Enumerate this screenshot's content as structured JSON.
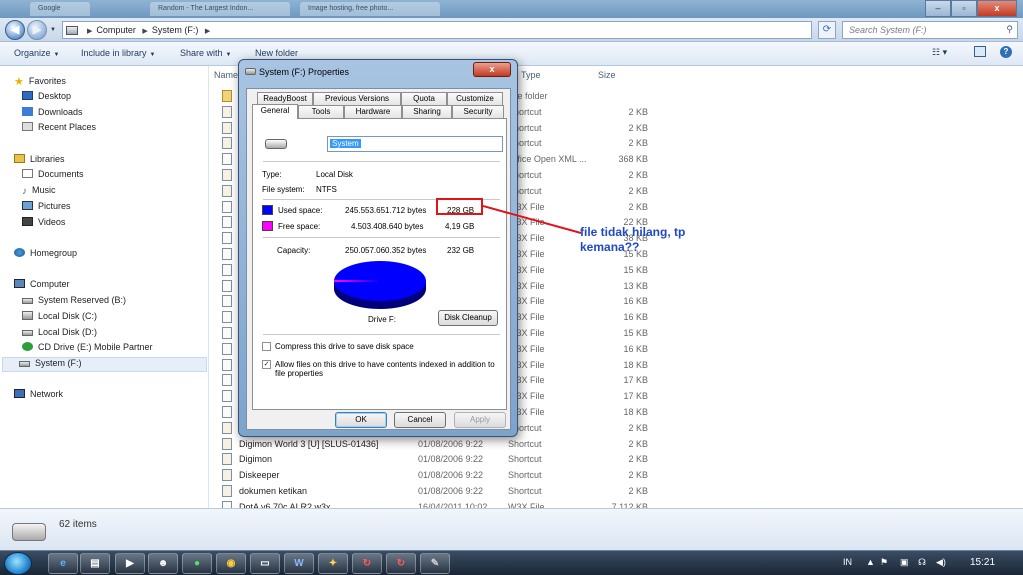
{
  "topbar": {
    "tab1": "Google",
    "tab2": "Random - The Largest Indon...",
    "tab3": "Image hosting, free photo..."
  },
  "window_buttons": {
    "minimize": "–",
    "maximize": "▫",
    "close": "x"
  },
  "address": {
    "crumbs": [
      "Computer",
      "System (F:)"
    ],
    "search_placeholder": "Search System (F:)"
  },
  "commands": {
    "organize": "Organize",
    "include": "Include in library",
    "share": "Share with",
    "newfolder": "New folder"
  },
  "columns": {
    "name": "Name",
    "date": "Date modified",
    "type": "Type",
    "size": "Size"
  },
  "nav": {
    "favorites": "Favorites",
    "desktop": "Desktop",
    "downloads": "Downloads",
    "recent": "Recent Places",
    "libraries": "Libraries",
    "documents": "Documents",
    "music": "Music",
    "pictures": "Pictures",
    "videos": "Videos",
    "homegroup": "Homegroup",
    "computer": "Computer",
    "sysres": "System Reserved (B:)",
    "diskc": "Local Disk (C:)",
    "diskd": "Local Disk (D:)",
    "cdrive": "CD Drive (E:) Mobile Partner",
    "systemf": "System (F:)",
    "network": "Network"
  },
  "files": [
    {
      "name": "",
      "date": "",
      "type": "File folder",
      "size": ""
    },
    {
      "name": "",
      "date": "",
      "type": "Shortcut",
      "size": "2 KB"
    },
    {
      "name": "",
      "date": "",
      "type": "Shortcut",
      "size": "2 KB"
    },
    {
      "name": "",
      "date": "",
      "type": "Shortcut",
      "size": "2 KB"
    },
    {
      "name": "",
      "date": "",
      "type": "Office Open XML ...",
      "size": "368 KB"
    },
    {
      "name": "",
      "date": "",
      "type": "Shortcut",
      "size": "2 KB"
    },
    {
      "name": "",
      "date": "",
      "type": "Shortcut",
      "size": "2 KB"
    },
    {
      "name": "",
      "date": "",
      "type": "W3X File",
      "size": "2 KB"
    },
    {
      "name": "",
      "date": "",
      "type": "W3X File",
      "size": "22 KB"
    },
    {
      "name": "",
      "date": "",
      "type": "W3X File",
      "size": "38 KB"
    },
    {
      "name": "",
      "date": "",
      "type": "W3X File",
      "size": "15 KB"
    },
    {
      "name": "",
      "date": "",
      "type": "W3X File",
      "size": "15 KB"
    },
    {
      "name": "",
      "date": "",
      "type": "W3X File",
      "size": "13 KB"
    },
    {
      "name": "",
      "date": "",
      "type": "W3X File",
      "size": "16 KB"
    },
    {
      "name": "",
      "date": "",
      "type": "W3X File",
      "size": "16 KB"
    },
    {
      "name": "",
      "date": "",
      "type": "W3X File",
      "size": "15 KB"
    },
    {
      "name": "",
      "date": "",
      "type": "W3X File",
      "size": "16 KB"
    },
    {
      "name": "",
      "date": "",
      "type": "W3X File",
      "size": "18 KB"
    },
    {
      "name": "",
      "date": "",
      "type": "W3X File",
      "size": "17 KB"
    },
    {
      "name": "",
      "date": "",
      "type": "W3X File",
      "size": "17 KB"
    },
    {
      "name": "",
      "date": "",
      "type": "W3X File",
      "size": "18 KB"
    },
    {
      "name": "",
      "date": "",
      "type": "Shortcut",
      "size": "2 KB"
    },
    {
      "name": "Digimon World 3 [U] [SLUS-01436]",
      "date": "01/08/2006 9:22",
      "type": "Shortcut",
      "size": "2 KB"
    },
    {
      "name": "Digimon",
      "date": "01/08/2006 9:22",
      "type": "Shortcut",
      "size": "2 KB"
    },
    {
      "name": "Diskeeper",
      "date": "01/08/2006 9:22",
      "type": "Shortcut",
      "size": "2 KB"
    },
    {
      "name": "dokumen ketikan",
      "date": "01/08/2006 9:22",
      "type": "Shortcut",
      "size": "2 KB"
    },
    {
      "name": "DotA v6.70c AI R2.w3x",
      "date": "16/04/2011 10:02",
      "type": "W3X File",
      "size": "7.112 KB"
    }
  ],
  "status": {
    "items": "62 items"
  },
  "dialog": {
    "title": "System (F:) Properties",
    "close": "x",
    "tabs_row1": [
      "ReadyBoost",
      "Previous Versions",
      "Quota",
      "Customize"
    ],
    "tabs_row2": [
      "General",
      "Tools",
      "Hardware",
      "Sharing",
      "Security"
    ],
    "name_value": "System",
    "type_label": "Type:",
    "type_value": "Local Disk",
    "fs_label": "File system:",
    "fs_value": "NTFS",
    "used_label": "Used space:",
    "used_bytes": "245.553.651.712 bytes",
    "used_gb": "228 GB",
    "free_label": "Free space:",
    "free_bytes": "4.503.408.640 bytes",
    "free_gb": "4,19 GB",
    "cap_label": "Capacity:",
    "cap_bytes": "250.057.060.352 bytes",
    "cap_gb": "232 GB",
    "drive_label": "Drive F:",
    "cleanup": "Disk Cleanup",
    "compress": "Compress this drive to save disk space",
    "index": "Allow files on this drive to have contents indexed in addition to file properties",
    "ok": "OK",
    "cancel": "Cancel",
    "apply": "Apply",
    "used_color": "#0000ff",
    "free_color": "#ff00ff",
    "used_fraction": 0.982
  },
  "annotation": {
    "line1": "file tidak hilang, tp",
    "line2": "kemana??"
  },
  "taskbar": {
    "lang": "IN",
    "time": "15:21"
  }
}
